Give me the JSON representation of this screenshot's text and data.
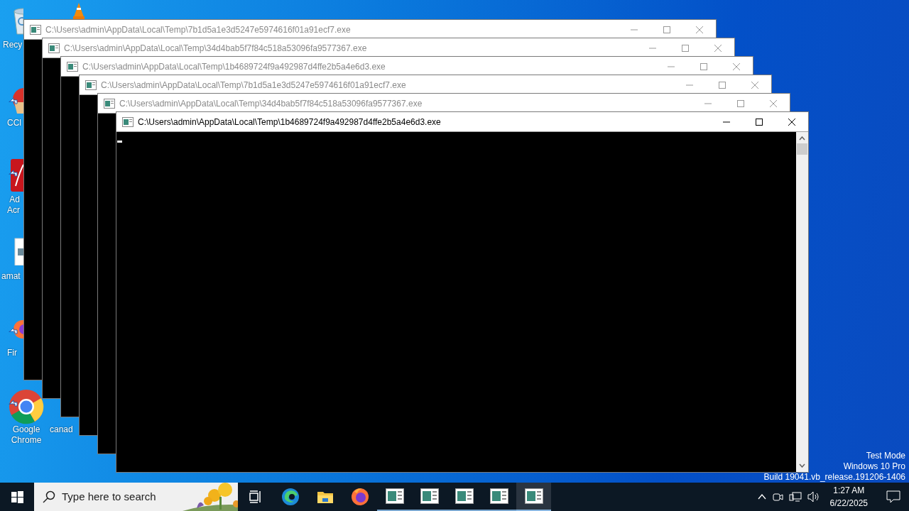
{
  "desktop_icons": [
    {
      "kind": "recycle",
      "lines": [
        "Recy"
      ]
    },
    {
      "kind": "ccleaner",
      "lines": [
        "CCl"
      ]
    },
    {
      "kind": "acrobat",
      "lines": [
        "Ad",
        "Acr"
      ]
    },
    {
      "kind": "image",
      "lines": [
        "amat"
      ]
    },
    {
      "kind": "firefox",
      "lines": [
        "Fir"
      ]
    },
    {
      "kind": "chrome",
      "lines": [
        "Google",
        "Chrome"
      ]
    },
    {
      "kind": "document",
      "lines": [
        "canad"
      ]
    },
    {
      "kind": "vlc"
    }
  ],
  "windows": [
    {
      "title": "C:\\Users\\admin\\AppData\\Local\\Temp\\7b1d5a1e3d5247e5974616f01a91ecf7.exe",
      "active": false
    },
    {
      "title": "C:\\Users\\admin\\AppData\\Local\\Temp\\34d4bab5f7f84c518a53096fa9577367.exe",
      "active": false
    },
    {
      "title": "C:\\Users\\admin\\AppData\\Local\\Temp\\1b4689724f9a492987d4ffe2b5a4e6d3.exe",
      "active": false
    },
    {
      "title": "C:\\Users\\admin\\AppData\\Local\\Temp\\7b1d5a1e3d5247e5974616f01a91ecf7.exe",
      "active": false
    },
    {
      "title": "C:\\Users\\admin\\AppData\\Local\\Temp\\34d4bab5f7f84c518a53096fa9577367.exe",
      "active": false
    },
    {
      "title": "C:\\Users\\admin\\AppData\\Local\\Temp\\1b4689724f9a492987d4ffe2b5a4e6d3.exe",
      "active": true
    }
  ],
  "watermark_lines": [
    "Test Mode",
    "Windows 10 Pro",
    "Build 19041.vb_release.191206-1406"
  ],
  "taskbar": {
    "search": {
      "placeholder": "Type here to search"
    },
    "apps": [
      {
        "kind": "taskview",
        "active": false
      },
      {
        "kind": "edge",
        "active": false
      },
      {
        "kind": "explorer",
        "active": false
      },
      {
        "kind": "firefox",
        "active": false
      },
      {
        "kind": "console",
        "active": false
      },
      {
        "kind": "console",
        "active": false
      },
      {
        "kind": "console",
        "active": false
      },
      {
        "kind": "console",
        "active": false
      },
      {
        "kind": "console",
        "active": true
      }
    ],
    "time": "1:27 AM",
    "date": "6/22/2025"
  }
}
